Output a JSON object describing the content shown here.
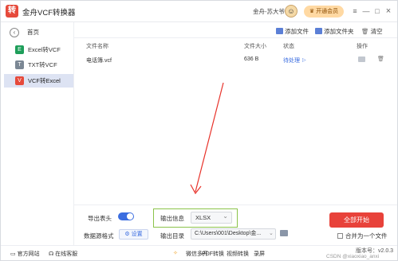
{
  "app": {
    "title": "金舟VCF转换器",
    "user": "金舟-苏大爷",
    "vip_label": "开通会员"
  },
  "window_controls": {
    "menu": "≡",
    "minimize": "—",
    "maximize": "□",
    "close": "×"
  },
  "sidebar": {
    "home_label": "首页",
    "items": [
      {
        "label": "Excel转VCF",
        "icon": "excel-icon",
        "active": false,
        "color": "#1e9e5a"
      },
      {
        "label": "TXT转VCF",
        "icon": "txt-icon",
        "active": false,
        "color": "#e64a3b"
      },
      {
        "label": "VCF转Excel",
        "icon": "vcf-icon",
        "active": true,
        "color": "#e64a3b"
      }
    ]
  },
  "toolbar": {
    "add_file": "添加文件",
    "add_folder": "添加文件夹",
    "clear": "清空"
  },
  "table": {
    "headers": [
      "文件名称",
      "文件大小",
      "状态",
      "操作"
    ],
    "rows": [
      {
        "name": "电话簿.vcf",
        "size": "636 B",
        "status": "待处理"
      }
    ]
  },
  "bottom": {
    "export_header_label": "导出表头",
    "export_header_on": true,
    "data_source_label": "数据源格式",
    "settings_label": "设置",
    "output_info_label": "输出信息",
    "output_format": "XLSX",
    "output_dir_label": "输出目录",
    "output_dir": "C:\\Users\\001\\Desktop\\金...",
    "start_button": "全部开始",
    "merge_label": "合并为一个文件"
  },
  "statusbar": {
    "website": "官方网站",
    "support": "在线客服",
    "links": [
      "微信多开",
      "PDF转换",
      "视频转换",
      "录屏"
    ],
    "version": "版本号：v2.0.3",
    "watermark": "CSDN @xiaoxiao_anxi"
  },
  "colors": {
    "accent": "#3b6de0",
    "start": "#e8423a",
    "highlight_box": "#8bc34a",
    "annotation_arrow": "#e8332b"
  }
}
